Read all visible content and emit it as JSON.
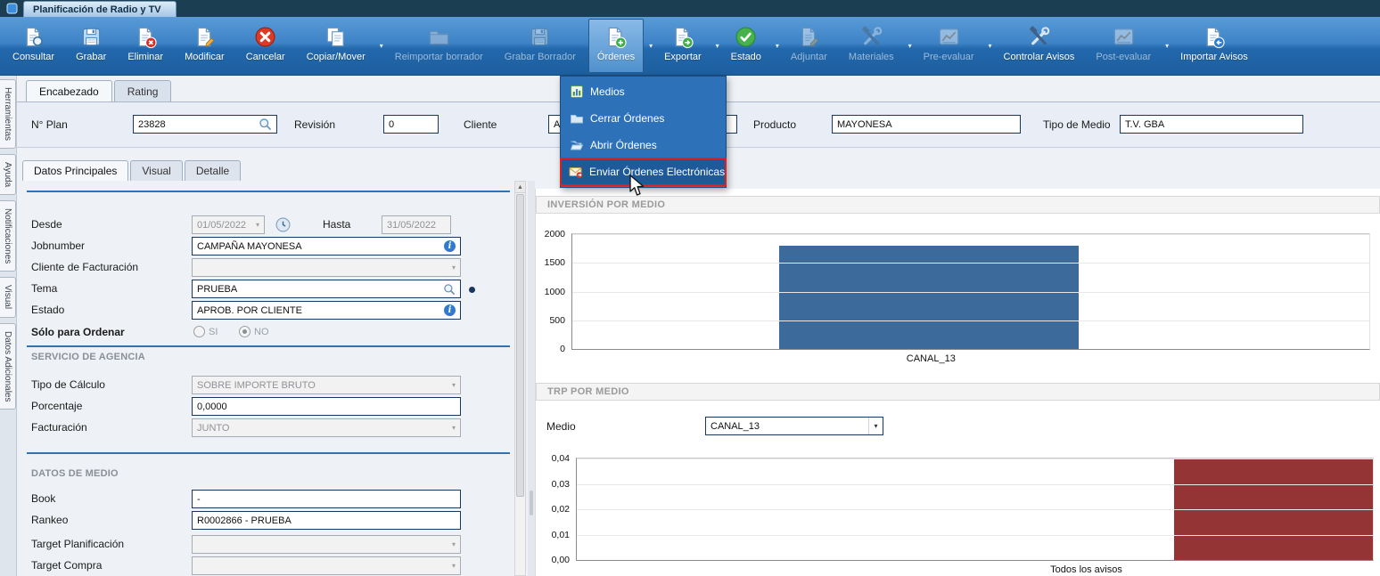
{
  "window": {
    "tab_title": "Planificación de Radio y TV"
  },
  "toolbar": {
    "items": [
      {
        "label": "Consultar",
        "icon": "consult-icon",
        "enabled": true,
        "dropdown": false,
        "active": false
      },
      {
        "label": "Grabar",
        "icon": "save-icon",
        "enabled": true,
        "dropdown": false,
        "active": false
      },
      {
        "label": "Eliminar",
        "icon": "delete-doc-icon",
        "enabled": true,
        "dropdown": false,
        "active": false
      },
      {
        "label": "Modificar",
        "icon": "edit-doc-icon",
        "enabled": true,
        "dropdown": false,
        "active": false
      },
      {
        "label": "Cancelar",
        "icon": "cancel-icon",
        "enabled": true,
        "dropdown": false,
        "active": false
      },
      {
        "label": "Copiar/Mover",
        "icon": "copy-icon",
        "enabled": true,
        "dropdown": true,
        "active": false
      },
      {
        "label": "Reimportar borrador",
        "icon": "folder-icon",
        "enabled": false,
        "dropdown": false,
        "active": false
      },
      {
        "label": "Grabar Borrador",
        "icon": "save-draft-icon",
        "enabled": false,
        "dropdown": false,
        "active": false
      },
      {
        "label": "Órdenes",
        "icon": "orders-add-icon",
        "enabled": true,
        "dropdown": true,
        "active": true
      },
      {
        "label": "Exportar",
        "icon": "export-icon",
        "enabled": true,
        "dropdown": true,
        "active": false
      },
      {
        "label": "Estado",
        "icon": "status-icon",
        "enabled": true,
        "dropdown": true,
        "active": false
      },
      {
        "label": "Adjuntar",
        "icon": "attach-icon",
        "enabled": false,
        "dropdown": false,
        "active": false
      },
      {
        "label": "Materiales",
        "icon": "materials-icon",
        "enabled": false,
        "dropdown": true,
        "active": false
      },
      {
        "label": "Pre-evaluar",
        "icon": "pre-evaluate-icon",
        "enabled": false,
        "dropdown": true,
        "active": false
      },
      {
        "label": "Controlar Avisos",
        "icon": "control-ads-icon",
        "enabled": true,
        "dropdown": false,
        "active": false
      },
      {
        "label": "Post-evaluar",
        "icon": "post-evaluate-icon",
        "enabled": false,
        "dropdown": true,
        "active": false
      },
      {
        "label": "Importar Avisos",
        "icon": "import-ads-icon",
        "enabled": true,
        "dropdown": false,
        "active": false
      }
    ]
  },
  "orders_menu": {
    "items": [
      {
        "label": "Medios",
        "icon": "media-icon",
        "highlighted": false
      },
      {
        "label": "Cerrar Órdenes",
        "icon": "close-orders-icon",
        "highlighted": false
      },
      {
        "label": "Abrir Órdenes",
        "icon": "open-orders-icon",
        "highlighted": false
      },
      {
        "label": "Enviar Órdenes Electrónicas",
        "icon": "send-electronic-orders-icon",
        "highlighted": true
      }
    ]
  },
  "side_tabs": [
    {
      "label": "Herramientas"
    },
    {
      "label": "Ayuda"
    },
    {
      "label": "Notificaciones"
    },
    {
      "label": "Visual"
    },
    {
      "label": "Datos Adicionales"
    }
  ],
  "header_tabs": [
    {
      "label": "Encabezado",
      "active": true
    },
    {
      "label": "Rating",
      "active": false
    }
  ],
  "header_fields": {
    "plan": {
      "label": "N° Plan",
      "value": "23828"
    },
    "revision": {
      "label": "Revisión",
      "value": "0"
    },
    "cliente": {
      "label": "Cliente",
      "value": "A"
    },
    "producto": {
      "label": "Producto",
      "value": "MAYONESA"
    },
    "tipo_medio": {
      "label": "Tipo de Medio",
      "value": "T.V. GBA"
    }
  },
  "detail_tabs": [
    {
      "label": "Datos Principales",
      "active": true
    },
    {
      "label": "Visual",
      "active": false
    },
    {
      "label": "Detalle",
      "active": false
    }
  ],
  "form": {
    "desde": {
      "label": "Desde",
      "value": "01/05/2022"
    },
    "hasta": {
      "label": "Hasta",
      "value": "31/05/2022"
    },
    "jobnumber": {
      "label": "Jobnumber",
      "value": "CAMPAÑA MAYONESA"
    },
    "cliente_facturacion": {
      "label": "Cliente de Facturación",
      "value": ""
    },
    "tema": {
      "label": "Tema",
      "value": "PRUEBA"
    },
    "estado": {
      "label": "Estado",
      "value": "APROB. POR CLIENTE"
    },
    "solo_para_ordenar": {
      "label": "Sólo para Ordenar",
      "options": [
        "SI",
        "NO"
      ],
      "selected": "NO"
    },
    "servicio_agencia": {
      "section_title": "SERVICIO DE AGENCIA",
      "tipo_calculo": {
        "label": "Tipo de Cálculo",
        "value": "SOBRE IMPORTE BRUTO"
      },
      "porcentaje": {
        "label": "Porcentaje",
        "value": "0,0000"
      },
      "facturacion": {
        "label": "Facturación",
        "value": "JUNTO"
      }
    },
    "datos_medio": {
      "section_title": "DATOS DE MEDIO",
      "book": {
        "label": "Book",
        "value": "-"
      },
      "rankeo": {
        "label": "Rankeo",
        "value": "R0002866 - PRUEBA"
      },
      "target_planificacion": {
        "label": "Target Planificación",
        "value": ""
      },
      "target_compra": {
        "label": "Target Compra",
        "value": ""
      }
    }
  },
  "charts": {
    "medio_selector": {
      "label": "Medio",
      "value": "CANAL_13"
    }
  },
  "chart_data": [
    {
      "type": "bar",
      "title": "INVERSIÓN POR MEDIO",
      "categories": [
        "CANAL_13"
      ],
      "values": [
        1800
      ],
      "ylim": [
        0,
        2000
      ],
      "yticks": [
        "2000",
        "1500",
        "1000",
        "500",
        "0"
      ],
      "ylabel": "",
      "xlabel": "",
      "grid": true,
      "bar_color": "#3c6a9a",
      "bar_left_pct": 26,
      "bar_width_pct": 37.5,
      "label_center_pct": 45
    },
    {
      "type": "bar",
      "title": "TRP POR MEDIO",
      "categories": [
        "Todos los avisos"
      ],
      "values": [
        0.04
      ],
      "ylim": [
        0,
        0.04
      ],
      "yticks": [
        "0,04",
        "0,03",
        "0,02",
        "0,01",
        "0,00"
      ],
      "ylabel": "",
      "xlabel": "",
      "grid": true,
      "bar_color": "#943434",
      "bar_left_pct": 75,
      "bar_width_pct": 25,
      "label_center_pct": 64
    }
  ],
  "colors": {
    "menu_bg": "#2d72b8",
    "highlight_border": "#e02020",
    "accent_blue": "#2e74b5",
    "bar_blue": "#3c6a9a",
    "bar_red": "#943434"
  }
}
